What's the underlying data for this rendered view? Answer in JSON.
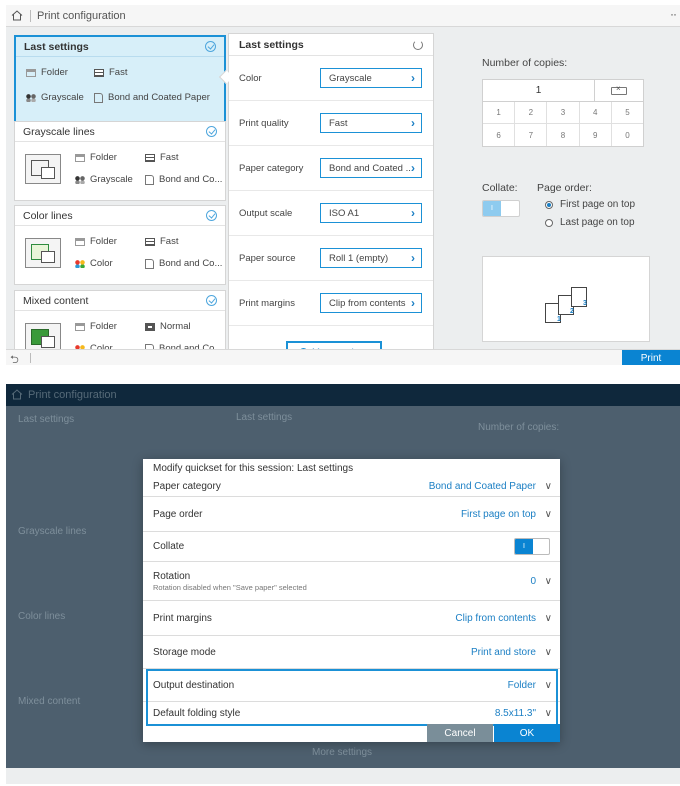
{
  "app_title": "Print configuration",
  "print_label": "Print",
  "quicksets": [
    {
      "title": "Last settings",
      "props": {
        "output": "Folder",
        "quality": "Fast",
        "color": "Grayscale",
        "paper": "Bond and Coated Paper"
      }
    },
    {
      "title": "Grayscale lines",
      "props": {
        "output": "Folder",
        "quality": "Fast",
        "color": "Grayscale",
        "paper": "Bond and Co..."
      }
    },
    {
      "title": "Color lines",
      "props": {
        "output": "Folder",
        "quality": "Fast",
        "color": "Color",
        "paper": "Bond and Co..."
      }
    },
    {
      "title": "Mixed content",
      "props": {
        "output": "Folder",
        "quality": "Normal",
        "color": "Color",
        "paper": "Bond and Co..."
      }
    }
  ],
  "settings_panel": {
    "title": "Last settings",
    "rows": [
      {
        "label": "Color",
        "value": "Grayscale"
      },
      {
        "label": "Print quality",
        "value": "Fast"
      },
      {
        "label": "Paper category",
        "value": "Bond and Coated ..."
      },
      {
        "label": "Output scale",
        "value": "ISO A1"
      },
      {
        "label": "Paper source",
        "value": "Roll 1 (empty)"
      },
      {
        "label": "Print margins",
        "value": "Clip from contents"
      }
    ],
    "more_label": "More settings"
  },
  "copies": {
    "label": "Number of copies:",
    "value": "1",
    "keys": [
      [
        "1",
        "2",
        "3",
        "4",
        "5"
      ],
      [
        "6",
        "7",
        "8",
        "9",
        "0"
      ]
    ]
  },
  "collate": {
    "label": "Collate:",
    "on_text": "I"
  },
  "page_order": {
    "label": "Page order:",
    "options": [
      {
        "label": "First page on top",
        "selected": true
      },
      {
        "label": "Last page on top",
        "selected": false
      }
    ]
  },
  "preview_pages": [
    "1",
    "2",
    "3"
  ],
  "dialog": {
    "title": "Modify quickset for this session: Last settings",
    "rows": [
      {
        "label": "Paper category",
        "value": "Bond and Coated Paper"
      },
      {
        "label": "Page order",
        "value": "First page on top"
      },
      {
        "label": "Collate",
        "value": "I"
      },
      {
        "label": "Rotation",
        "sub": "Rotation disabled when \"Save paper\" selected",
        "value": "0"
      },
      {
        "label": "Print margins",
        "value": "Clip from contents"
      },
      {
        "label": "Storage mode",
        "value": "Print and store"
      },
      {
        "label": "Output destination",
        "value": "Folder"
      },
      {
        "label": "Default folding style",
        "value": "8.5x11.3\""
      }
    ],
    "cancel_label": "Cancel",
    "ok_label": "OK"
  },
  "colors": {
    "accent": "#0a84d2",
    "selected_bg": "#d7eff9",
    "overlay": "#0f283c"
  }
}
